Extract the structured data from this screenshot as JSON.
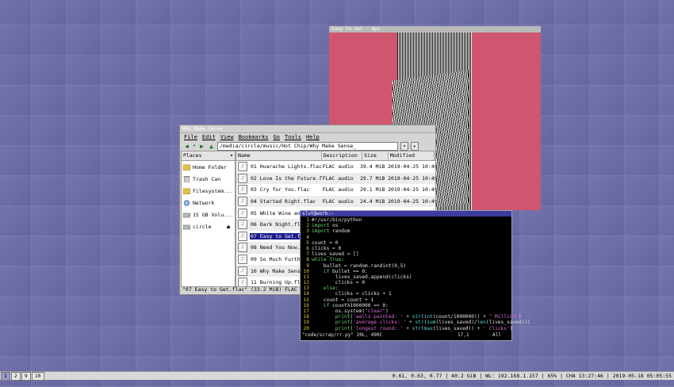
{
  "mpv": {
    "title": "Easy to Get - mpv"
  },
  "file_manager": {
    "title": "Why Make Sense_",
    "menu": [
      "File",
      "Edit",
      "View",
      "Bookmarks",
      "Go",
      "Tools",
      "Help"
    ],
    "path": "/media/circle/music/Hot Chip/Why Make Sense_",
    "places_header": "Places",
    "places": [
      "Home Folder",
      "Trash Can",
      "Filesystem...",
      "Network",
      "15 GB Volu...",
      "circle"
    ],
    "columns": {
      "name": "Name",
      "description": "Description",
      "size": "Size",
      "modified": "Modified"
    },
    "files": [
      {
        "name": "01 Huarache Lights.flac",
        "description": "FLAC audio",
        "size": "39.4 MiB",
        "modified": "2019-04-25 10:49"
      },
      {
        "name": "02 Love Is the Future.flac",
        "description": "FLAC audio",
        "size": "29.7 MiB",
        "modified": "2019-04-25 10:49"
      },
      {
        "name": "03 Cry for You.flac",
        "description": "FLAC audio",
        "size": "29.1 MiB",
        "modified": "2019-04-25 10:49"
      },
      {
        "name": "04 Started Right.flac",
        "description": "FLAC audio",
        "size": "24.4 MiB",
        "modified": "2019-04-25 10:49"
      },
      {
        "name": "05 White Wine and Fried Chicken.flac",
        "description": "",
        "size": "",
        "modified": ""
      },
      {
        "name": "06 Dark Night.flac",
        "description": "",
        "size": "",
        "modified": ""
      },
      {
        "name": "07 Easy to Get.flac",
        "description": "",
        "size": "",
        "modified": ""
      },
      {
        "name": "08 Need You Now.flac",
        "description": "",
        "size": "",
        "modified": ""
      },
      {
        "name": "09 So Much Further to Go.flac",
        "description": "",
        "size": "",
        "modified": ""
      },
      {
        "name": "10 Why Make Sense_.flac",
        "description": "",
        "size": "",
        "modified": ""
      },
      {
        "name": "11 Burning Up.flac",
        "description": "",
        "size": "",
        "modified": ""
      }
    ],
    "status": "\"07 Easy to Get.flac\" (33.2 MiB) FLAC audio"
  },
  "terminal": {
    "title": "slut@work:~",
    "lines": [
      {
        "n": "1",
        "t": [
          [
            "c",
            "#!/usr/bin/python"
          ]
        ]
      },
      {
        "n": "2",
        "t": [
          [
            "k",
            "import"
          ],
          [
            "c",
            " os"
          ]
        ]
      },
      {
        "n": "3",
        "t": [
          [
            "k",
            "import"
          ],
          [
            "c",
            " random"
          ]
        ]
      },
      {
        "n": "4",
        "t": []
      },
      {
        "n": "5",
        "t": [
          [
            "c",
            "count = 0"
          ]
        ]
      },
      {
        "n": "6",
        "t": [
          [
            "c",
            "clicks = 0"
          ]
        ]
      },
      {
        "n": "7",
        "t": [
          [
            "c",
            "lives_saved = []"
          ]
        ]
      },
      {
        "n": "8",
        "t": [
          [
            "k",
            "while True"
          ],
          [
            "c",
            ":"
          ]
        ]
      },
      {
        "n": "9",
        "t": [
          [
            "c",
            "    bullet = random.randint(0,5)"
          ]
        ]
      },
      {
        "n": "10",
        "t": [
          [
            "c",
            "    "
          ],
          [
            "k",
            "if"
          ],
          [
            "c",
            " bullet == 0:"
          ]
        ]
      },
      {
        "n": "11",
        "t": [
          [
            "c",
            "        lives_saved.append(clicks)"
          ]
        ]
      },
      {
        "n": "12",
        "t": [
          [
            "c",
            "        clicks = 0"
          ]
        ]
      },
      {
        "n": "13",
        "t": [
          [
            "c",
            "    "
          ],
          [
            "k",
            "else"
          ],
          [
            "c",
            ":"
          ]
        ]
      },
      {
        "n": "14",
        "t": [
          [
            "c",
            "        clicks = clicks + 1"
          ]
        ]
      },
      {
        "n": "15",
        "t": [
          [
            "c",
            "    count = count + 1"
          ]
        ]
      },
      {
        "n": "16",
        "t": [
          [
            "c",
            "    "
          ],
          [
            "k",
            "if"
          ],
          [
            "c",
            " count%1000000 == 0:"
          ]
        ]
      },
      {
        "n": "17",
        "t": [
          [
            "c",
            "        os.system("
          ],
          [
            "s",
            "\"clear\""
          ],
          [
            "c",
            ")"
          ]
        ]
      },
      {
        "n": "18",
        "t": [
          [
            "c",
            "        "
          ],
          [
            "k",
            "print"
          ],
          [
            "c",
            "("
          ],
          [
            "s",
            "'walls painted: '"
          ],
          [
            "c",
            " + "
          ],
          [
            "b",
            "str"
          ],
          [
            "c",
            "("
          ],
          [
            "b",
            "int"
          ],
          [
            "c",
            "(count/1000000)) + "
          ],
          [
            "s",
            "\" Million\""
          ],
          [
            "c",
            ")"
          ]
        ]
      },
      {
        "n": "19",
        "t": [
          [
            "c",
            "        "
          ],
          [
            "k",
            "print"
          ],
          [
            "c",
            "("
          ],
          [
            "s",
            "'average clicks: '"
          ],
          [
            "c",
            " + "
          ],
          [
            "b",
            "str"
          ],
          [
            "c",
            "("
          ],
          [
            "b",
            "sum"
          ],
          [
            "c",
            "(lives_saved)/"
          ],
          [
            "b",
            "len"
          ],
          [
            "c",
            "(lives_saved)))"
          ]
        ]
      },
      {
        "n": "20",
        "t": [
          [
            "c",
            "        "
          ],
          [
            "k",
            "print"
          ],
          [
            "c",
            "("
          ],
          [
            "s",
            "'longest round: '"
          ],
          [
            "c",
            " + "
          ],
          [
            "b",
            "str"
          ],
          [
            "c",
            "("
          ],
          [
            "b",
            "max"
          ],
          [
            "c",
            "(lives_saved)) + "
          ],
          [
            "s",
            "' clicks'"
          ],
          [
            "c",
            ")"
          ]
        ]
      }
    ],
    "status_file": "\"code/scrap/rr.py\" 20L, 490C",
    "status_pos": "17,1",
    "status_all": "All"
  },
  "taskbar": {
    "workspaces": [
      "1",
      "2",
      "9",
      "10"
    ],
    "sysinfo": "0.61, 0.63, 0.77 | 40.2 GiB | WL: 192.168.1.157 | 65% | CHA 13:27:46 | 2019-05-18 05:05:55"
  },
  "colors": {
    "desktop": "#6a6aa6",
    "mpv_bg": "#d0566f",
    "selection": "#1a1a8a",
    "terminal_title": "#3c3c9c"
  }
}
